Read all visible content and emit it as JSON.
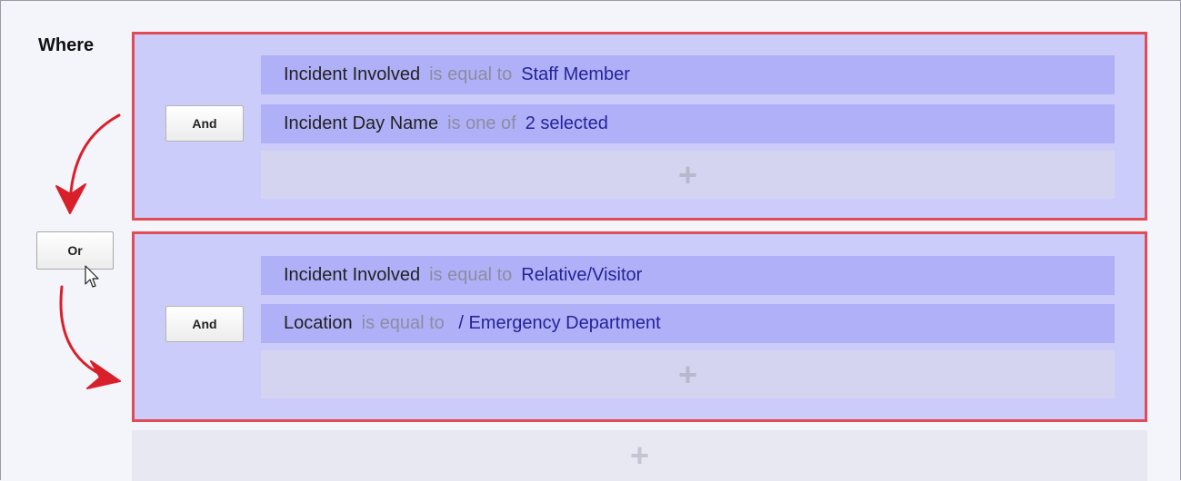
{
  "where_label": "Where",
  "or_label": "Or",
  "groups": [
    {
      "and_label": "And",
      "conditions": [
        {
          "field": "Incident Involved",
          "operator": "is equal to",
          "value": "Staff Member"
        },
        {
          "field": "Incident Day Name",
          "operator": "is one of",
          "value": "2 selected"
        }
      ],
      "add_symbol": "+"
    },
    {
      "and_label": "And",
      "conditions": [
        {
          "field": "Incident Involved",
          "operator": "is equal to",
          "value": "Relative/Visitor"
        },
        {
          "field": "Location",
          "operator": "is equal to",
          "value": " / Emergency Department"
        }
      ],
      "add_symbol": "+"
    }
  ],
  "add_group_symbol": "+",
  "colors": {
    "group_border": "#e24a55",
    "group_bg": "#ccccfa",
    "condition_bg": "#b0b0f8",
    "value_text": "#24249a",
    "operator_text": "#8c8ca2",
    "annotation_arrow": "#d8202a"
  },
  "icons": [
    "curved-arrow-down-icon",
    "curved-arrow-right-icon",
    "mouse-cursor-icon",
    "plus-icon"
  ]
}
